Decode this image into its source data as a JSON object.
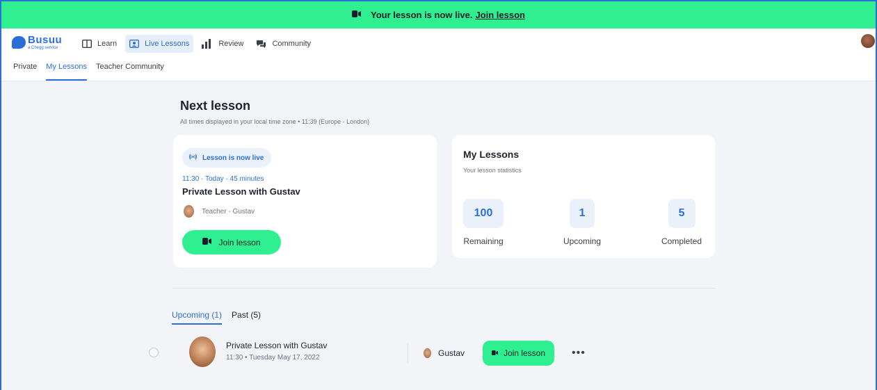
{
  "banner": {
    "text": "Your lesson is now live.",
    "link": "Join lesson"
  },
  "logo": {
    "name": "Busuu",
    "sub": "a Chegg service"
  },
  "nav": [
    {
      "label": "Learn",
      "icon": "book-icon"
    },
    {
      "label": "Live Lessons",
      "icon": "live-lessons-icon"
    },
    {
      "label": "Review",
      "icon": "bar-chart-icon"
    },
    {
      "label": "Community",
      "icon": "chat-icon"
    }
  ],
  "subnav": [
    "Private",
    "My Lessons",
    "Teacher Community"
  ],
  "next": {
    "title": "Next lesson",
    "timezone": "All times displayed in your local time zone • 11:39 (Europe - London)",
    "live_label": "Lesson is now live",
    "meta": "11:30 · Today · 45 minutes",
    "lesson_name": "Private Lesson with Gustav",
    "teacher": "Teacher - Gustav",
    "join_label": "Join lesson"
  },
  "stats": {
    "title": "My Lessons",
    "subtitle": "Your lesson statistics",
    "items": [
      {
        "value": "100",
        "label": "Remaining"
      },
      {
        "value": "1",
        "label": "Upcoming"
      },
      {
        "value": "5",
        "label": "Completed"
      }
    ]
  },
  "tabs": [
    "Upcoming (1)",
    "Past (5)"
  ],
  "row": {
    "title": "Private Lesson with Gustav",
    "date": "11:30 • Tuesday May 17, 2022",
    "teacher": "Gustav",
    "join_label": "Join lesson",
    "more": "•••"
  },
  "colors": {
    "accent": "#2b6fd6",
    "live_green": "#2ef090",
    "background": "#f3f4f8"
  }
}
